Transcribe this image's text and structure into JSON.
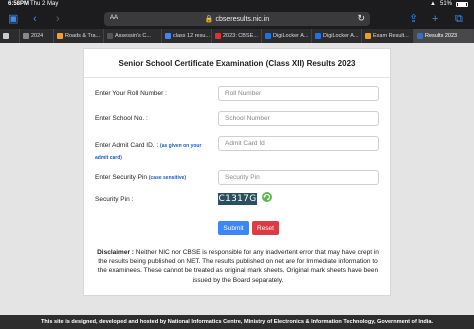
{
  "status_bar": {
    "time": "6:58PM",
    "date": "Thu 2 May",
    "battery": "51%"
  },
  "browser": {
    "address": "cbseresults.nic.in",
    "aa": "AA",
    "tabs": [
      {
        "label": "",
        "fav_color": "#cccccc"
      },
      {
        "label": "2024",
        "fav_color": "#888888"
      },
      {
        "label": "Roads & Tra...",
        "fav_color": "#f0a030"
      },
      {
        "label": "Assessin's C...",
        "fav_color": "#555555"
      },
      {
        "label": "class 12 resu...",
        "fav_color": "#4285f4"
      },
      {
        "label": "2023: CBSE...",
        "fav_color": "#e03030"
      },
      {
        "label": "DigiLocker A...",
        "fav_color": "#1a73e8"
      },
      {
        "label": "DigiLocker A...",
        "fav_color": "#1a73e8"
      },
      {
        "label": "Exam Result...",
        "fav_color": "#e8a020"
      },
      {
        "label": "Results 2023",
        "fav_color": "#3a6fbf"
      }
    ]
  },
  "form": {
    "title": "Senior School Certificate Examination (Class XII) Results 2023",
    "roll_label": "Enter Your Roll Number :",
    "roll_placeholder": "Roll Number",
    "school_label": "Enter School No. :",
    "school_placeholder": "School Number",
    "admit_label": "Enter Admit Card ID. :",
    "admit_note": "(as given on your admit card)",
    "admit_placeholder": "Admit Card Id",
    "pin_label": "Enter Security Pin",
    "pin_note": "(case sensitive)",
    "pin_placeholder": "Security Pin",
    "captcha_label": "Security Pin :",
    "captcha_value": "C1317G",
    "submit": "Submit",
    "reset": "Reset"
  },
  "disclaimer": {
    "title": "Disclaimer :",
    "text": "Neither NIC nor CBSE is responsible for any inadvertent error that may have crept in the results being published on NET. The results published on net are for Immediate information to the examinees. These cannot be treated as original mark sheets. Original mark sheets have been issued by the Board separately."
  },
  "footer": "This site is designed, developed and hosted by National Informatics Centre, Ministry of Electronics & Information Technology, Government of India.",
  "colors": {
    "accent": "#3d86f5",
    "reset": "#dc3b45",
    "captcha_bg": "#2a4f5e"
  }
}
